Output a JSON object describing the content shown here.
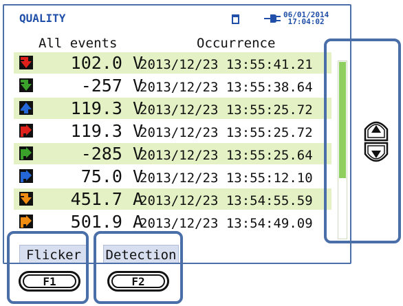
{
  "header": {
    "title": "QUALITY",
    "date": "06/01/2014",
    "time": "17:04:02"
  },
  "columns": {
    "event": "All events",
    "occurrence": "Occurrence"
  },
  "events": [
    {
      "icon": "red-down-arrow-icon",
      "value": "102.0 V",
      "time": "2013/12/23 13:55:41.21"
    },
    {
      "icon": "green-down-arrow-icon",
      "value": "-257 V",
      "time": "2013/12/23 13:55:38.64"
    },
    {
      "icon": "blue-up-arrow-icon",
      "value": "119.3 V",
      "time": "2013/12/23 13:55:25.72"
    },
    {
      "icon": "red-right-arrow-icon",
      "value": "119.3 V",
      "time": "2013/12/23 13:55:25.72"
    },
    {
      "icon": "green-right-arrow-icon",
      "value": "-285 V",
      "time": "2013/12/23 13:55:25.64"
    },
    {
      "icon": "blue-right-arrow-icon",
      "value": "75.0 V",
      "time": "2013/12/23 13:55:12.10"
    },
    {
      "icon": "orange-down-arrow-icon",
      "value": "451.7 A",
      "time": "2013/12/23 13:54:55.59"
    },
    {
      "icon": "orange-right-arrow-icon",
      "value": "501.9 A",
      "time": "2013/12/23 13:54:49.09"
    }
  ],
  "scroll": {
    "thumb_fraction": 0.66
  },
  "function_keys": {
    "f1_label": "Flicker",
    "f2_label": "Detection",
    "f1_key": "F1",
    "f2_key": "F2"
  },
  "colors": {
    "accent": "#1f4fa8",
    "highlight": "#4a6ea8",
    "row_alt": "#e3f1c4",
    "scroll_thumb": "#8fcf60"
  }
}
